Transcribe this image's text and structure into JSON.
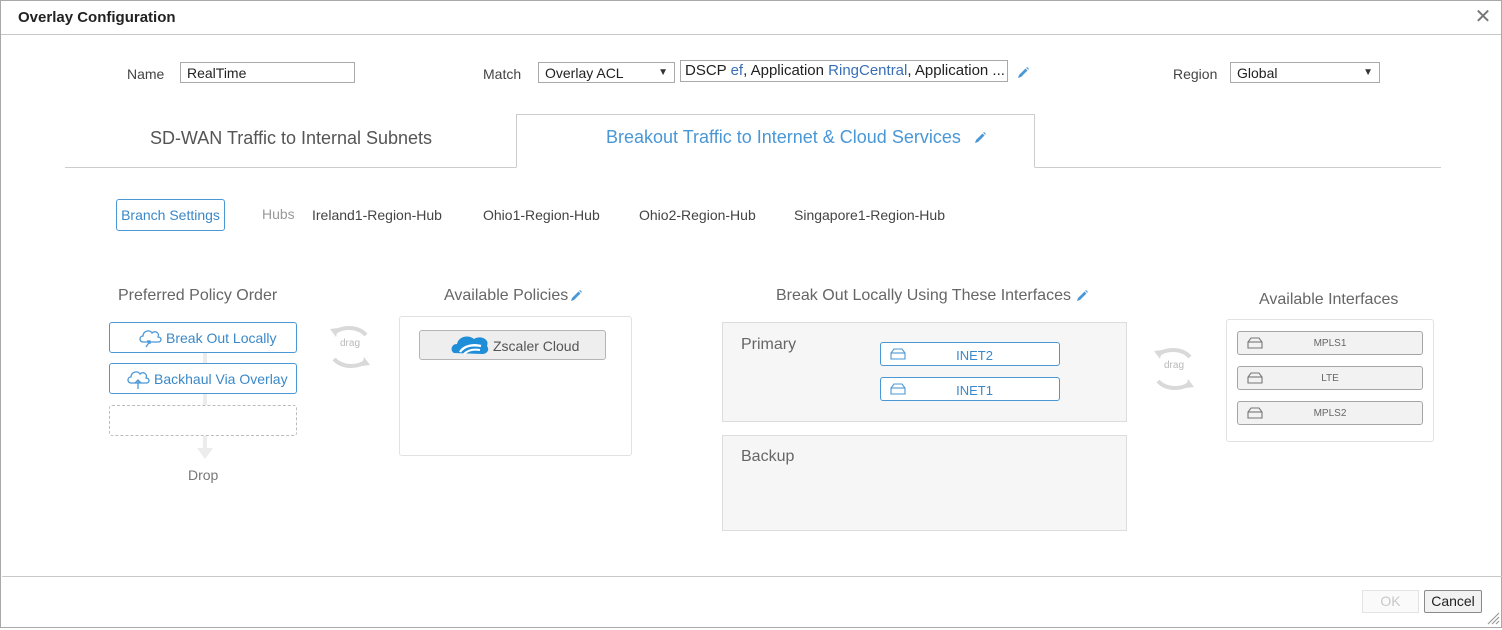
{
  "dialog": {
    "title": "Overlay Configuration"
  },
  "form": {
    "name_label": "Name",
    "name_value": "RealTime",
    "match_label": "Match",
    "match_select": "Overlay ACL",
    "match_summary": {
      "part1": "DSCP ",
      "dscp_value": "ef",
      "part2": ", Application ",
      "app_value": "RingCentral",
      "part3": ", Application ..."
    },
    "region_label": "Region",
    "region_select": "Global"
  },
  "tabs": [
    {
      "label": "SD-WAN Traffic to Internal Subnets",
      "active": false
    },
    {
      "label": "Breakout Traffic to Internet & Cloud Services",
      "active": true
    }
  ],
  "hubs": {
    "branch_settings_label": "Branch Settings",
    "hubs_label": "Hubs",
    "items": [
      "Ireland1-Region-Hub",
      "Ohio1-Region-Hub",
      "Ohio2-Region-Hub",
      "Singapore1-Region-Hub"
    ]
  },
  "policy_order": {
    "title": "Preferred Policy Order",
    "items": [
      "Break Out Locally",
      "Backhaul Via Overlay"
    ],
    "drop_label": "Drop"
  },
  "drag_label": "drag",
  "available_policies": {
    "title": "Available Policies",
    "items": [
      "Zscaler Cloud"
    ]
  },
  "breakout_interfaces": {
    "title": "Break Out Locally Using These Interfaces",
    "primary_label": "Primary",
    "primary_items": [
      "INET2",
      "INET1"
    ],
    "backup_label": "Backup"
  },
  "available_interfaces": {
    "title": "Available Interfaces",
    "items": [
      "MPLS1",
      "LTE",
      "MPLS2"
    ]
  },
  "footer": {
    "ok_label": "OK",
    "cancel_label": "Cancel"
  },
  "colors": {
    "accent": "#4a97d6",
    "link_blue": "#3a6fb5",
    "panel_grey": "#f6f6f6"
  }
}
